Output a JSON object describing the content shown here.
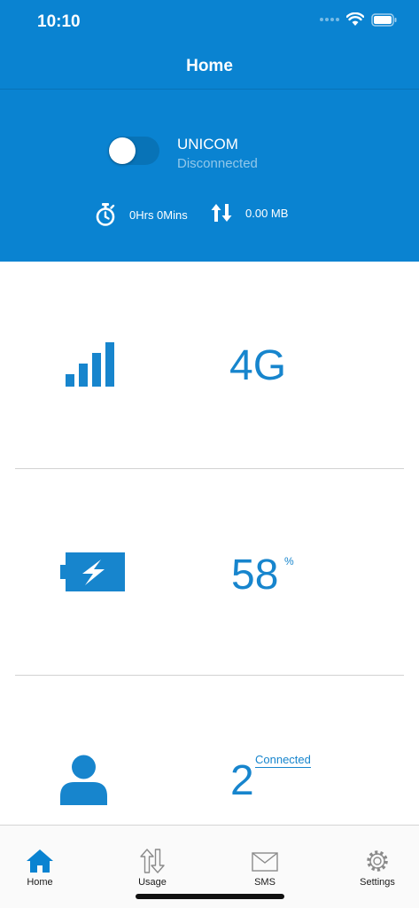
{
  "status_bar": {
    "time": "10:10"
  },
  "nav": {
    "title": "Home"
  },
  "connection": {
    "enabled": false,
    "carrier": "UNICOM",
    "status": "Disconnected",
    "duration": "0Hrs 0Mins",
    "data_usage": "0.00 MB"
  },
  "network": {
    "type": "4G",
    "icon": "signal-bars-icon"
  },
  "battery": {
    "value": "58",
    "unit": "%",
    "icon": "battery-charging-icon"
  },
  "devices": {
    "count": "2",
    "label": "Connected",
    "icon": "person-icon"
  },
  "tabs": [
    {
      "label": "Home",
      "icon": "home-icon",
      "active": true
    },
    {
      "label": "Usage",
      "icon": "updown-arrows-icon",
      "active": false
    },
    {
      "label": "SMS",
      "icon": "envelope-icon",
      "active": false
    },
    {
      "label": "Settings",
      "icon": "gear-icon",
      "active": false
    }
  ],
  "colors": {
    "primary": "#0a83d1",
    "accent": "#1785cd",
    "tab_icon_inactive": "#8a8a8a"
  }
}
